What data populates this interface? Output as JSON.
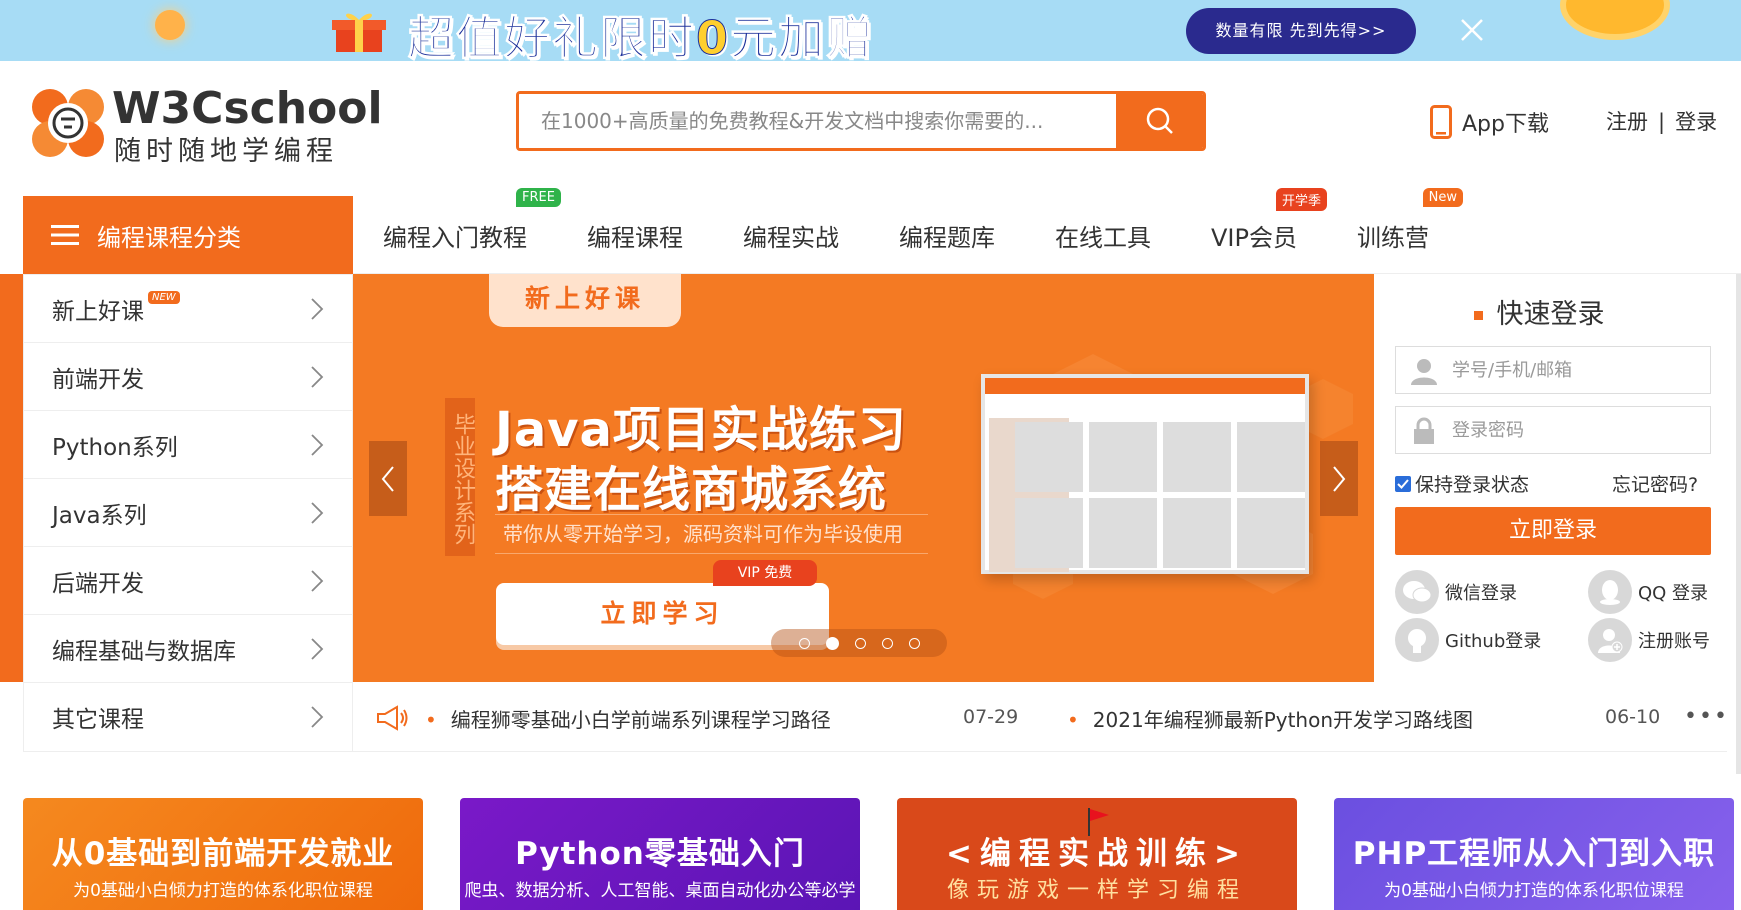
{
  "promo": {
    "headline_part1": "超值好礼限时",
    "headline_hl": "0",
    "headline_part2": "元加赠",
    "cta": "数量有限 先到先得>>"
  },
  "header": {
    "logo_name": "W3Cschool",
    "logo_slogan": "随时随地学编程",
    "search_placeholder": "在1000+高质量的免费教程&开发文档中搜索你需要的...",
    "app_download": "App下载",
    "register": "注册",
    "separator": "|",
    "login": "登录"
  },
  "nav": {
    "category_label": "编程课程分类",
    "items": [
      {
        "label": "编程入门教程",
        "badge": "FREE",
        "badge_color": "#2fb34a"
      },
      {
        "label": "编程课程",
        "badge": "",
        "badge_color": ""
      },
      {
        "label": "编程实战",
        "badge": "",
        "badge_color": ""
      },
      {
        "label": "编程题库",
        "badge": "",
        "badge_color": ""
      },
      {
        "label": "在线工具",
        "badge": "",
        "badge_color": ""
      },
      {
        "label": "VIP会员",
        "badge": "开学季",
        "badge_color": "#e8421e"
      },
      {
        "label": "训练营",
        "badge": "New",
        "badge_color": "#f26b1d"
      }
    ]
  },
  "sidebar": {
    "items": [
      {
        "label": "新上好课",
        "new_tag": "NEW"
      },
      {
        "label": "前端开发",
        "new_tag": ""
      },
      {
        "label": "Python系列",
        "new_tag": ""
      },
      {
        "label": "Java系列",
        "new_tag": ""
      },
      {
        "label": "后端开发",
        "new_tag": ""
      },
      {
        "label": "编程基础与数据库",
        "new_tag": ""
      },
      {
        "label": "其它课程",
        "new_tag": ""
      }
    ]
  },
  "carousel": {
    "tag": "新上好课",
    "vertical_label": "毕业设计系列",
    "title_line1": "Java项目实战练习",
    "title_line2": "搭建在线商城系统",
    "subtitle": "带你从零开始学习，源码资料可作为毕设使用",
    "cta": "立即学习",
    "vip_badge": "VIP 免费",
    "slide_count": 5,
    "active_slide": 2
  },
  "quick_login": {
    "title": "快速登录",
    "account_placeholder": "学号/手机/邮箱",
    "password_placeholder": "登录密码",
    "remember_label": "保持登录状态",
    "remember_checked": true,
    "forgot": "忘记密码?",
    "submit": "立即登录",
    "wechat": "微信登录",
    "qq": "QQ 登录",
    "github": "Github登录",
    "register": "注册账号"
  },
  "notices": [
    {
      "text": "编程狮零基础小白学前端系列课程学习路径",
      "date": "07-29"
    },
    {
      "text": "2021年编程狮最新Python开发学习路线图",
      "date": "06-10"
    }
  ],
  "notice_more": "•••",
  "cards": [
    {
      "title": "从0基础到前端开发就业",
      "subtitle": "为0基础小白倾力打造的体系化职位课程"
    },
    {
      "title": "Python零基础入门",
      "subtitle": "爬虫、数据分析、人工智能、桌面自动化办公等必学"
    },
    {
      "title": "<编程实战训练>",
      "subtitle": "像玩游戏一样学习编程"
    },
    {
      "title": "PHP工程师从入门到入职",
      "subtitle": "为0基础小白倾力打造的体系化职位课程"
    }
  ],
  "colors": {
    "brand_orange": "#f26b1d",
    "promo_bg": "#a7dcf5",
    "checkbox_blue": "#2a6dd9"
  }
}
